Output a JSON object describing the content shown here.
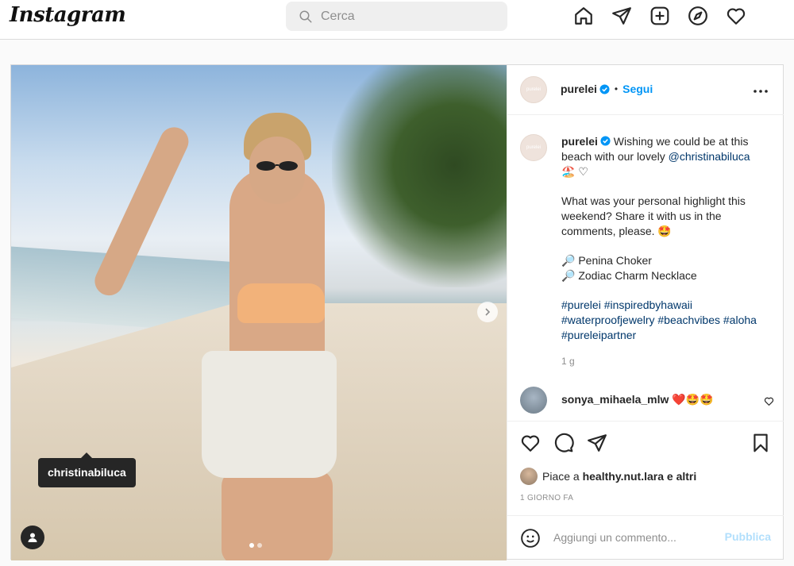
{
  "topbar": {
    "logo": "Instagram",
    "search_placeholder": "Cerca",
    "nav_icons": [
      "home-icon",
      "direct-icon",
      "new-post-icon",
      "explore-icon",
      "activity-icon"
    ]
  },
  "post": {
    "username": "purelei",
    "follow_label": "Segui",
    "separator": "•",
    "avatar_text": "purelei",
    "caption": {
      "line1_text": "Wishing we could be at this beach with our lovely ",
      "mention": "@christinabiluca",
      "emojis1": "🏖️ ♡",
      "para2": "What was your personal highlight this weekend? Share it with us in the comments, please. 🤩",
      "item1": "🔎 Penina Choker",
      "item2": "🔎 Zodiac Charm Necklace",
      "hashtags": "#purelei #inspiredbyhawaii #waterproofjewelry #beachvibes #aloha #pureleipartner"
    },
    "caption_time": "1 g",
    "comment": {
      "username": "sonya_mihaela_mlw",
      "text": "❤️🤩🤩"
    },
    "likes": {
      "prefix": "Piace a ",
      "user": "healthy.nut.lara",
      "suffix": " e altri"
    },
    "date": "1 GIORNO FA",
    "comment_placeholder": "Aggiungi un commento...",
    "publish_label": "Pubblica",
    "photo_tag": "christinabiluca",
    "carousel": {
      "current": 1,
      "total": 2
    }
  },
  "colors": {
    "accent": "#0095f6",
    "hashtag": "#00376b",
    "publish_disabled": "#b2dffc"
  }
}
